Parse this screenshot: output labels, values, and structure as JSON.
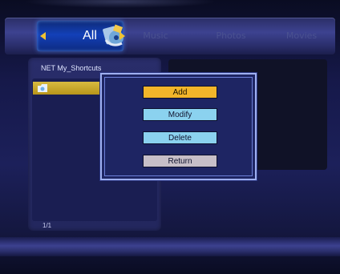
{
  "tabs": {
    "all": "All",
    "music": "Music",
    "photos": "Photos",
    "movies": "Movies",
    "selected": "All"
  },
  "browser": {
    "path": "NET  My_Shortcuts",
    "page": "1/1"
  },
  "popup": {
    "add": "Add",
    "modify": "Modify",
    "delete": "Delete",
    "return": "Return",
    "focused": "Add"
  },
  "colors": {
    "focus_button": "#f2b52a",
    "menu_button": "#8bd2ef",
    "return_button": "#c7bfc8",
    "selected_row": "#d8ba40",
    "active_tab": "#1340b8"
  },
  "icons": {
    "all_tab": "media-mix-icon",
    "list_item": "folder-shortcut-icon"
  }
}
